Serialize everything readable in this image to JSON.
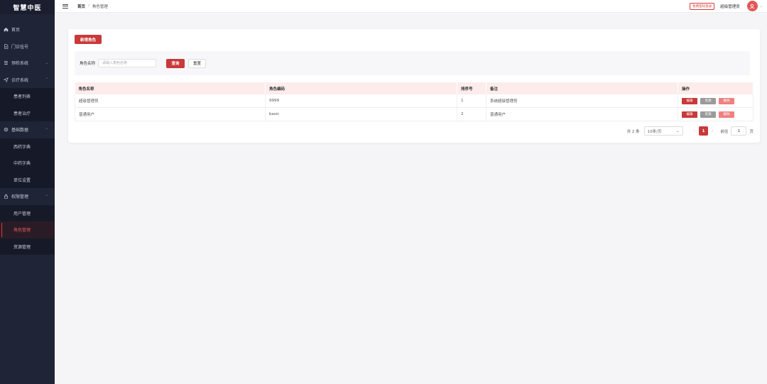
{
  "app": {
    "brand": "智慧中医"
  },
  "sidebar": {
    "items": [
      {
        "label": "首页",
        "icon": "home-icon"
      },
      {
        "label": "门诊挂号",
        "icon": "document-icon"
      },
      {
        "label": "预检系统",
        "icon": "list-icon",
        "arrow": "⌄"
      },
      {
        "label": "诊疗系统",
        "icon": "send-icon",
        "arrow": "⌃"
      },
      {
        "label": "患者列表",
        "sub": true
      },
      {
        "label": "患者治疗",
        "sub": true
      },
      {
        "label": "基础数据",
        "icon": "gear-icon",
        "arrow": "⌃"
      },
      {
        "label": "西药字典",
        "sub": true
      },
      {
        "label": "中药字典",
        "sub": true
      },
      {
        "label": "单位设置",
        "sub": true
      },
      {
        "label": "权限管理",
        "icon": "lock-icon",
        "arrow": "⌃"
      },
      {
        "label": "用户管理",
        "sub": true
      },
      {
        "label": "角色管理",
        "sub": true,
        "active": true
      },
      {
        "label": "资源管理",
        "sub": true
      }
    ]
  },
  "header": {
    "breadcrumb": {
      "home": "首页",
      "separator": "/",
      "current": "角色管理"
    },
    "badge": "免费密码登录",
    "user": "超级管理员",
    "caret": "⌄"
  },
  "toolbar": {
    "add_label": "新增角色"
  },
  "search": {
    "label": "角色名称",
    "placeholder": "请输入角色名称",
    "query_label": "查询",
    "reset_label": "重置"
  },
  "table": {
    "headers": [
      "角色名称",
      "角色编码",
      "排序号",
      "备注",
      "操作"
    ],
    "rows": [
      {
        "name": "超级管理员",
        "code": "9999",
        "order": "1",
        "remark": "系统超级管理员"
      },
      {
        "name": "普通用户",
        "code": "basic",
        "order": "2",
        "remark": "普通用户"
      }
    ],
    "actions": {
      "edit": "编辑",
      "resource": "资源",
      "delete": "删除"
    }
  },
  "pagination": {
    "total": "共 2 条",
    "page_size": "10条/页",
    "page_size_caret": "⌄",
    "prev": "‹",
    "next": "›",
    "current_page": "1",
    "goto_label": "前往",
    "goto_value": "1",
    "goto_unit": "页"
  },
  "colors": {
    "accent": "#c9393a",
    "sidebar_bg": "#1f2436",
    "header_row_bg": "#fdecec"
  }
}
